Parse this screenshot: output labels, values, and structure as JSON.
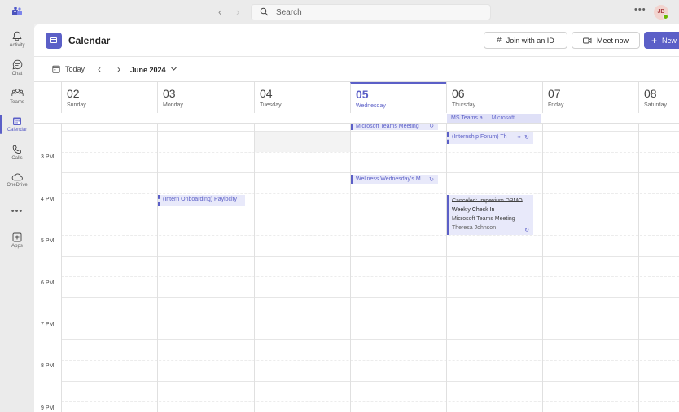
{
  "titlebar": {
    "search_placeholder": "Search",
    "more": "•••",
    "avatar_initials": "JB"
  },
  "rail": {
    "items": [
      {
        "label": "Activity",
        "icon": "bell-icon"
      },
      {
        "label": "Chat",
        "icon": "chat-icon"
      },
      {
        "label": "Teams",
        "icon": "teams-icon"
      },
      {
        "label": "Calendar",
        "icon": "calendar-icon"
      },
      {
        "label": "Calls",
        "icon": "phone-icon"
      },
      {
        "label": "OneDrive",
        "icon": "cloud-icon"
      },
      {
        "label": "Apps",
        "icon": "apps-icon"
      }
    ],
    "more": "•••",
    "active_color": "#5b5fc7"
  },
  "header": {
    "title": "Calendar",
    "join_label": "Join with an ID",
    "meet_label": "Meet now",
    "new_label": "New"
  },
  "toolbar": {
    "today_label": "Today",
    "month_label": "June 2024"
  },
  "days": [
    {
      "num": "02",
      "name": "Sunday"
    },
    {
      "num": "03",
      "name": "Monday"
    },
    {
      "num": "04",
      "name": "Tuesday"
    },
    {
      "num": "05",
      "name": "Wednesday"
    },
    {
      "num": "06",
      "name": "Thursday"
    },
    {
      "num": "07",
      "name": "Friday"
    },
    {
      "num": "08",
      "name": "Saturday"
    }
  ],
  "allday_event": {
    "title": "MS Teams a...",
    "subtitle": "Microsoft..."
  },
  "hours": [
    "3 PM",
    "4 PM",
    "5 PM",
    "6 PM",
    "7 PM",
    "8 PM",
    "9 PM"
  ],
  "events": {
    "wed_meeting": "Microsoft Teams Meeting",
    "thu_internship": "(Internship Forum) Th",
    "wed_wellness": "Wellness Wednesday's M",
    "mon_onboarding": "(Intern Onboarding) Paylocity",
    "thu_cancelled_line1": "Canceled: Impevium DPMO",
    "thu_cancelled_line2": "Weekly Check In",
    "thu_cancelled_line3": "Microsoft Teams Meeting",
    "thu_cancelled_line4": "Theresa Johnson"
  },
  "colors": {
    "accent": "#5b5fc7",
    "event_bg": "#e8e9fa"
  }
}
